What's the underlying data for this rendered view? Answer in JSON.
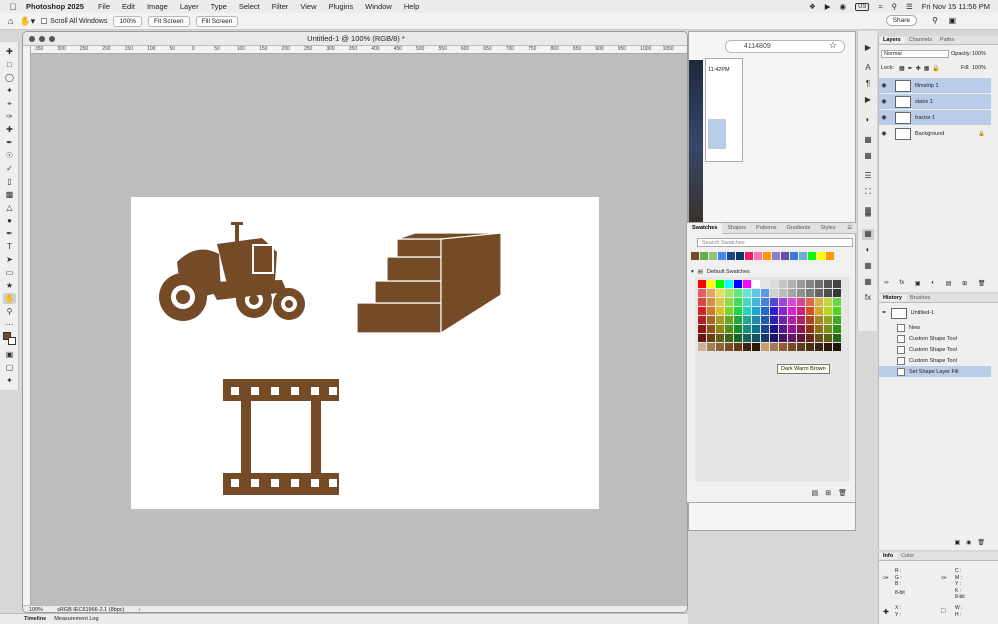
{
  "menubar": {
    "app_name": "Photoshop 2025",
    "items": [
      "File",
      "Edit",
      "Image",
      "Layer",
      "Type",
      "Select",
      "Filter",
      "View",
      "Plugins",
      "Window",
      "Help"
    ],
    "input_source": "US",
    "datetime": "Fri Nov 15  11:56 PM"
  },
  "options_bar": {
    "scroll_all_windows": "Scroll All Windows",
    "zoom_button": "100%",
    "fit_screen": "Fit Screen",
    "fill_screen": "Fill Screen",
    "share": "Share"
  },
  "document": {
    "title": "Untitled-1 @ 100% (RGB/8) *",
    "zoom": "100%",
    "color_profile": "sRGB IEC61966-2.1 (8bpc)",
    "ruler_ticks": [
      "350",
      "300",
      "250",
      "200",
      "150",
      "100",
      "50",
      "0",
      "50",
      "100",
      "150",
      "200",
      "250",
      "300",
      "350",
      "400",
      "450",
      "500",
      "550",
      "600",
      "650",
      "700",
      "750",
      "800",
      "850",
      "900",
      "950",
      "1000",
      "1050"
    ],
    "shape_color": "#744a27"
  },
  "browser": {
    "url_fragment": "4114809",
    "time": "11:42PM"
  },
  "swatches_panel": {
    "tabs": [
      "Swatches",
      "Shapes",
      "Patterns",
      "Gradients",
      "Styles"
    ],
    "search_placeholder": "Search Swatches",
    "group_name": "Default Swatches",
    "tooltip": "Dark Warm Brown",
    "recent_colors": [
      "#744a27",
      "#6aa84f",
      "#93c47d",
      "#4a86e8",
      "#1c4587",
      "#073763",
      "#e91e63",
      "#ff6fb0",
      "#ff9900",
      "#8e7cc3",
      "#674ea7",
      "#3c78d8",
      "#6fa8dc",
      "#00ff00",
      "#ffff00",
      "#ff9900"
    ]
  },
  "layers_panel": {
    "tabs": [
      "Layers",
      "Channels",
      "Paths"
    ],
    "blend_mode": "Normal",
    "opacity_label": "Opacity:",
    "opacity_value": "100%",
    "lock_label": "Lock:",
    "fill_label": "Fill:",
    "fill_value": "100%",
    "layers": [
      {
        "name": "filmstrip 1",
        "selected": true
      },
      {
        "name": "stairs 1",
        "selected": true
      },
      {
        "name": "tractor 1",
        "selected": true
      },
      {
        "name": "Background",
        "selected": false
      }
    ]
  },
  "history_panel": {
    "tabs": [
      "History",
      "Brushes"
    ],
    "snapshot": "Untitled-1",
    "steps": [
      "New",
      "Custom Shape Tool",
      "Custom Shape Tool",
      "Custom Shape Tool",
      "Set Shape Layer Fill"
    ]
  },
  "info_panel": {
    "tabs": [
      "Info",
      "Color"
    ],
    "left_labels": [
      "R :",
      "G :",
      "B :",
      "",
      "8-bit"
    ],
    "right_labels": [
      "C :",
      "M :",
      "Y :",
      "K :",
      "8-bit"
    ],
    "xy_labels": [
      "X :",
      "Y :"
    ],
    "wh_labels": [
      "W :",
      "H :"
    ]
  },
  "bottom_tabs": [
    "Timeline",
    "Measurement Log"
  ]
}
